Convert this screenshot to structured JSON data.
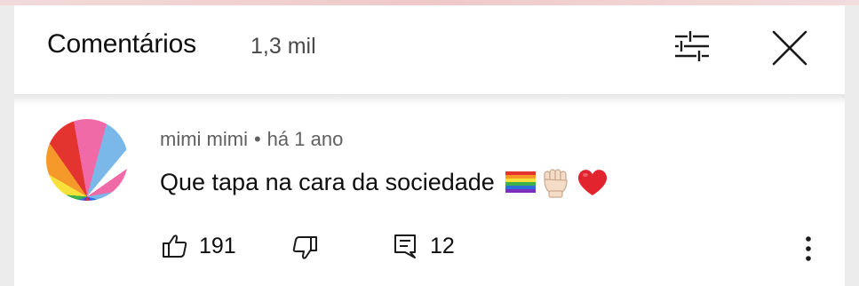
{
  "header": {
    "title": "Comentários",
    "count": "1,3 mil",
    "filter_icon": "sliders-icon",
    "close_icon": "close-icon"
  },
  "comment": {
    "author": "mimi mimi",
    "separator": "•",
    "time": "há 1 ano",
    "text": "Que tapa na cara da sociedade",
    "emojis": [
      "rainbow-flag-emoji",
      "raised-fist-emoji",
      "red-heart-emoji"
    ],
    "likes": "191",
    "replies": "12",
    "avatar_icon": "rainbow-avatar"
  },
  "colors": {
    "background": "#ffffff",
    "text_primary": "#0f0f0f",
    "text_secondary": "#606060"
  }
}
